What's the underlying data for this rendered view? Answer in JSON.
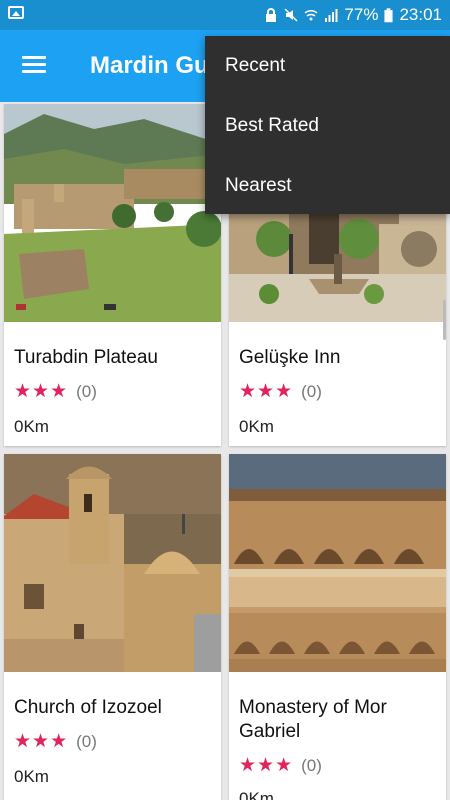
{
  "status_bar": {
    "battery": "77%",
    "time": "23:01"
  },
  "app_bar": {
    "title": "Mardin Guide"
  },
  "menu": {
    "items": [
      "Recent",
      "Best Rated",
      "Nearest"
    ]
  },
  "places": [
    {
      "name": "Turabdin Plateau",
      "rating": 3,
      "count": "(0)",
      "distance": "0Km"
    },
    {
      "name": "Gelüşke Inn",
      "rating": 3,
      "count": "(0)",
      "distance": "0Km"
    },
    {
      "name": "Church of Izozoel",
      "rating": 3,
      "count": "(0)",
      "distance": "0Km"
    },
    {
      "name": "Monastery of Mor Gabriel",
      "rating": 3,
      "count": "(0)",
      "distance": "0Km"
    }
  ],
  "colors": {
    "status_bar": "#1a8fd0",
    "app_bar": "#1da1f2",
    "star": "#e0245e",
    "menu_bg": "#2f2f2f"
  }
}
